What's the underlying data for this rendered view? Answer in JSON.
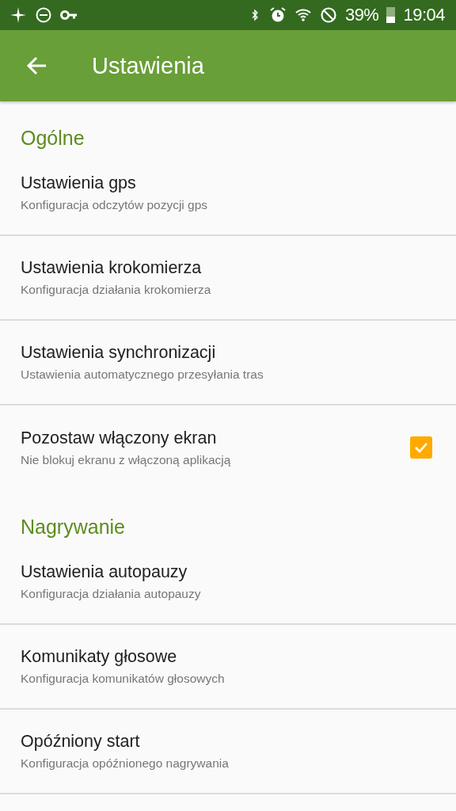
{
  "status_bar": {
    "battery": "39%",
    "time": "19:04"
  },
  "app_bar": {
    "title": "Ustawienia"
  },
  "sections": [
    {
      "header": "Ogólne",
      "items": [
        {
          "kind": "link",
          "title": "Ustawienia gps",
          "summary": "Konfiguracja odczytów pozycji gps"
        },
        {
          "kind": "link",
          "title": "Ustawienia krokomierza",
          "summary": "Konfiguracja działania krokomierza"
        },
        {
          "kind": "link",
          "title": "Ustawienia synchronizacji",
          "summary": "Ustawienia automatycznego przesyłania tras"
        },
        {
          "kind": "checkbox",
          "title": "Pozostaw włączony ekran",
          "summary": "Nie blokuj ekranu z włączoną aplikacją",
          "checked": true
        }
      ]
    },
    {
      "header": "Nagrywanie",
      "items": [
        {
          "kind": "link",
          "title": "Ustawienia autopauzy",
          "summary": "Konfiguracja działania autopauzy"
        },
        {
          "kind": "link",
          "title": "Komunikaty głosowe",
          "summary": "Konfiguracja komunikatów głosowych"
        },
        {
          "kind": "link",
          "title": "Opóźniony start",
          "summary": "Konfiguracja opóźnionego nagrywania"
        }
      ]
    }
  ]
}
